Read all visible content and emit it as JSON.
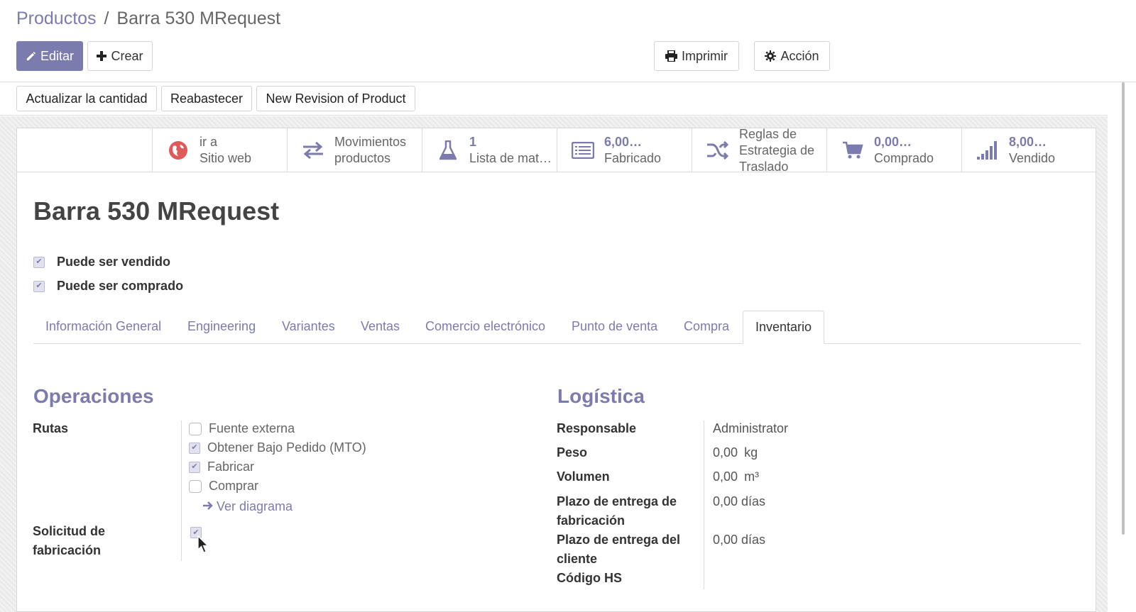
{
  "breadcrumb": {
    "parent": "Productos",
    "separator": "/",
    "current": "Barra 530 MRequest"
  },
  "toolbar": {
    "edit_label": "Editar",
    "create_label": "Crear",
    "print_label": "Imprimir",
    "action_label": "Acción"
  },
  "statusbar": {
    "update_qty": "Actualizar la cantidad",
    "replenish": "Reabastecer",
    "new_revision": "New Revision of Product"
  },
  "smart_buttons": [
    {
      "icon": "globe-icon",
      "value": "ir a",
      "label": "Sitio web"
    },
    {
      "icon": "exchange-icon",
      "value": "Movimientos",
      "label": "productos"
    },
    {
      "icon": "flask-icon",
      "value": "1",
      "label": "Lista de mat…"
    },
    {
      "icon": "list-icon",
      "value": "6,00…",
      "label": "Fabricado"
    },
    {
      "icon": "random-icon",
      "value": "Reglas de",
      "label": "Estrategia de",
      "label2": "Traslado"
    },
    {
      "icon": "cart-icon",
      "value": "0,00…",
      "label": "Comprado"
    },
    {
      "icon": "signal-icon",
      "value": "8,00…",
      "label": "Vendido"
    }
  ],
  "product": {
    "name": "Barra 530 MRequest",
    "can_be_sold": "Puede ser vendido",
    "can_be_purchased": "Puede ser comprado"
  },
  "tabs": [
    "Información General",
    "Engineering",
    "Variantes",
    "Ventas",
    "Comercio electrónico",
    "Punto de venta",
    "Compra",
    "Inventario"
  ],
  "active_tab": "Inventario",
  "operations": {
    "title": "Operaciones",
    "routes_label": "Rutas",
    "routes": [
      {
        "label": "Fuente externa",
        "checked": false
      },
      {
        "label": "Obtener Bajo Pedido (MTO)",
        "checked": true
      },
      {
        "label": "Fabricar",
        "checked": true
      },
      {
        "label": "Comprar",
        "checked": false
      }
    ],
    "view_diagram": "Ver diagrama",
    "manufacturing_request_label_1": "Solicitud de",
    "manufacturing_request_label_2": "fabricación",
    "manufacturing_request_checked": true
  },
  "logistics": {
    "title": "Logística",
    "responsible_label": "Responsable",
    "responsible_value": "Administrator",
    "weight_label": "Peso",
    "weight_value": "0,00",
    "weight_unit": "kg",
    "volume_label": "Volumen",
    "volume_value": "0,00",
    "volume_unit": "m³",
    "mfg_lead_label_1": "Plazo de entrega de",
    "mfg_lead_label_2": "fabricación",
    "mfg_lead_value": "0,00 días",
    "customer_lead_label_1": "Plazo de entrega del",
    "customer_lead_label_2": "cliente",
    "customer_lead_value": "0,00 días",
    "hs_code_label": "Código HS"
  },
  "colors": {
    "primary": "#7c7bad",
    "globe": "#e05a5a",
    "icon_gray": "#7c7bad"
  }
}
